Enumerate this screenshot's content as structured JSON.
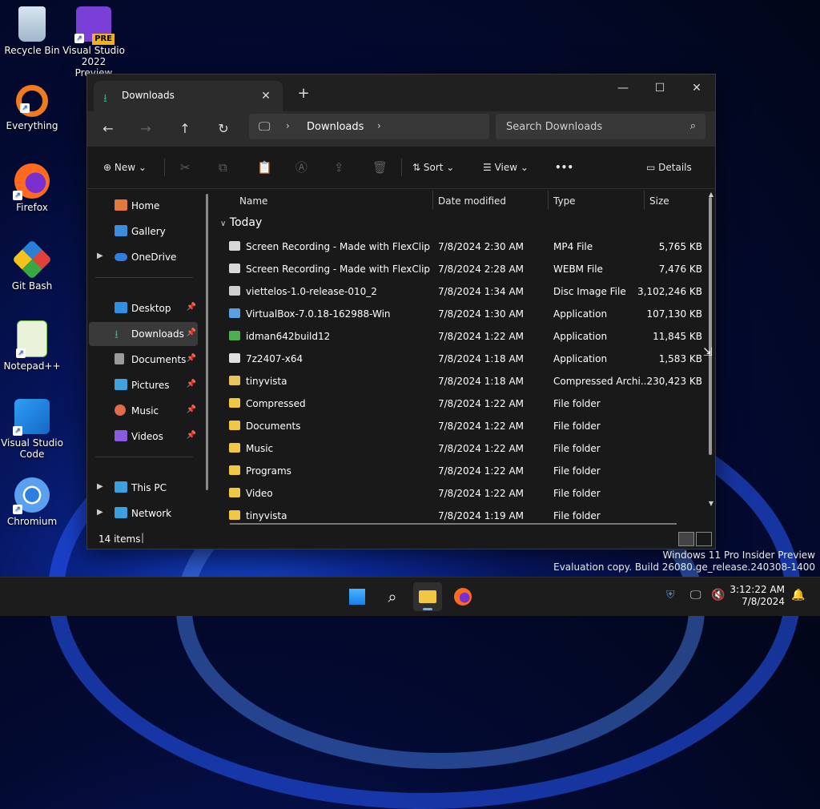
{
  "desktop_icons": [
    {
      "label": "Recycle Bin"
    },
    {
      "label": "Visual Studio 2022 Preview",
      "badge": "PRE"
    },
    {
      "label": "Everything"
    },
    {
      "label": "Firefox"
    },
    {
      "label": "Git Bash"
    },
    {
      "label": "Notepad++"
    },
    {
      "label": "Visual Studio Code"
    },
    {
      "label": "Chromium"
    }
  ],
  "window": {
    "tab_title": "Downloads",
    "address": {
      "location": "Downloads"
    },
    "search": {
      "placeholder": "Search Downloads"
    },
    "toolbar": {
      "new_label": "New",
      "sort_label": "Sort",
      "view_label": "View",
      "more_label": "•••",
      "details_label": "Details"
    },
    "sidebar": {
      "items": [
        {
          "label": "Home",
          "icon": "home-icon",
          "color": "#e07a3b"
        },
        {
          "label": "Gallery",
          "icon": "gallery-icon",
          "color": "#3b8de0"
        },
        {
          "label": "OneDrive",
          "icon": "cloud-icon",
          "color": "#2f7fe0"
        },
        {
          "label": "Desktop",
          "icon": "desktop-icon",
          "color": "#2f8fe0"
        },
        {
          "label": "Downloads",
          "icon": "download-icon",
          "color": "#2aa876"
        },
        {
          "label": "Documents",
          "icon": "document-icon",
          "color": "#9a9a9a"
        },
        {
          "label": "Pictures",
          "icon": "picture-icon",
          "color": "#3fa2e0"
        },
        {
          "label": "Music",
          "icon": "music-icon",
          "color": "#e06a4b"
        },
        {
          "label": "Videos",
          "icon": "video-icon",
          "color": "#8a5be0"
        },
        {
          "label": "This PC",
          "icon": "pc-icon",
          "color": "#3ba0e0"
        },
        {
          "label": "Network",
          "icon": "network-icon",
          "color": "#3ba0e0"
        }
      ]
    },
    "columns": {
      "name": "Name",
      "date": "Date modified",
      "type": "Type",
      "size": "Size"
    },
    "group_label": "Today",
    "files": [
      {
        "name": "Screen Recording - Made with FlexClip",
        "date": "7/8/2024 2:30 AM",
        "type": "MP4 File",
        "size": "5,765 KB",
        "icon_color": "#d8d8d8"
      },
      {
        "name": "Screen Recording - Made with FlexClip",
        "date": "7/8/2024 2:28 AM",
        "type": "WEBM File",
        "size": "7,476 KB",
        "icon_color": "#d8d8d8"
      },
      {
        "name": "viettelos-1.0-release-010_2",
        "date": "7/8/2024 1:34 AM",
        "type": "Disc Image File",
        "size": "3,102,246 KB",
        "icon_color": "#cfcfcf"
      },
      {
        "name": "VirtualBox-7.0.18-162988-Win",
        "date": "7/8/2024 1:30 AM",
        "type": "Application",
        "size": "107,130 KB",
        "icon_color": "#5aa0e0"
      },
      {
        "name": "idman642build12",
        "date": "7/8/2024 1:22 AM",
        "type": "Application",
        "size": "11,845 KB",
        "icon_color": "#4caf50"
      },
      {
        "name": "7z2407-x64",
        "date": "7/8/2024 1:18 AM",
        "type": "Application",
        "size": "1,583 KB",
        "icon_color": "#e0e0e0"
      },
      {
        "name": "tinyvista",
        "date": "7/8/2024 1:18 AM",
        "type": "Compressed Archi...",
        "size": "230,423 KB",
        "icon_color": "#e8c45a"
      },
      {
        "name": "Compressed",
        "date": "7/8/2024 1:22 AM",
        "type": "File folder",
        "size": "",
        "icon_color": "#f2c744"
      },
      {
        "name": "Documents",
        "date": "7/8/2024 1:22 AM",
        "type": "File folder",
        "size": "",
        "icon_color": "#f2c744"
      },
      {
        "name": "Music",
        "date": "7/8/2024 1:22 AM",
        "type": "File folder",
        "size": "",
        "icon_color": "#f2c744"
      },
      {
        "name": "Programs",
        "date": "7/8/2024 1:22 AM",
        "type": "File folder",
        "size": "",
        "icon_color": "#f2c744"
      },
      {
        "name": "Video",
        "date": "7/8/2024 1:22 AM",
        "type": "File folder",
        "size": "",
        "icon_color": "#f2c744"
      },
      {
        "name": "tinyvista",
        "date": "7/8/2024 1:19 AM",
        "type": "File folder",
        "size": "",
        "icon_color": "#f2c744"
      }
    ],
    "status": {
      "items": "14 items"
    }
  },
  "watermark": {
    "line1": "Windows 11 Pro Insider Preview",
    "line2": "Evaluation copy. Build 26080.ge_release.240308-1400"
  },
  "taskbar": {
    "apps": [
      "start-icon",
      "search-icon",
      "file-explorer-icon",
      "firefox-icon"
    ],
    "time": "3:12:22 AM",
    "date": "7/8/2024"
  },
  "colors": {
    "accent": "#2aa876",
    "folder": "#f2c744",
    "window_bg": "#191919"
  }
}
